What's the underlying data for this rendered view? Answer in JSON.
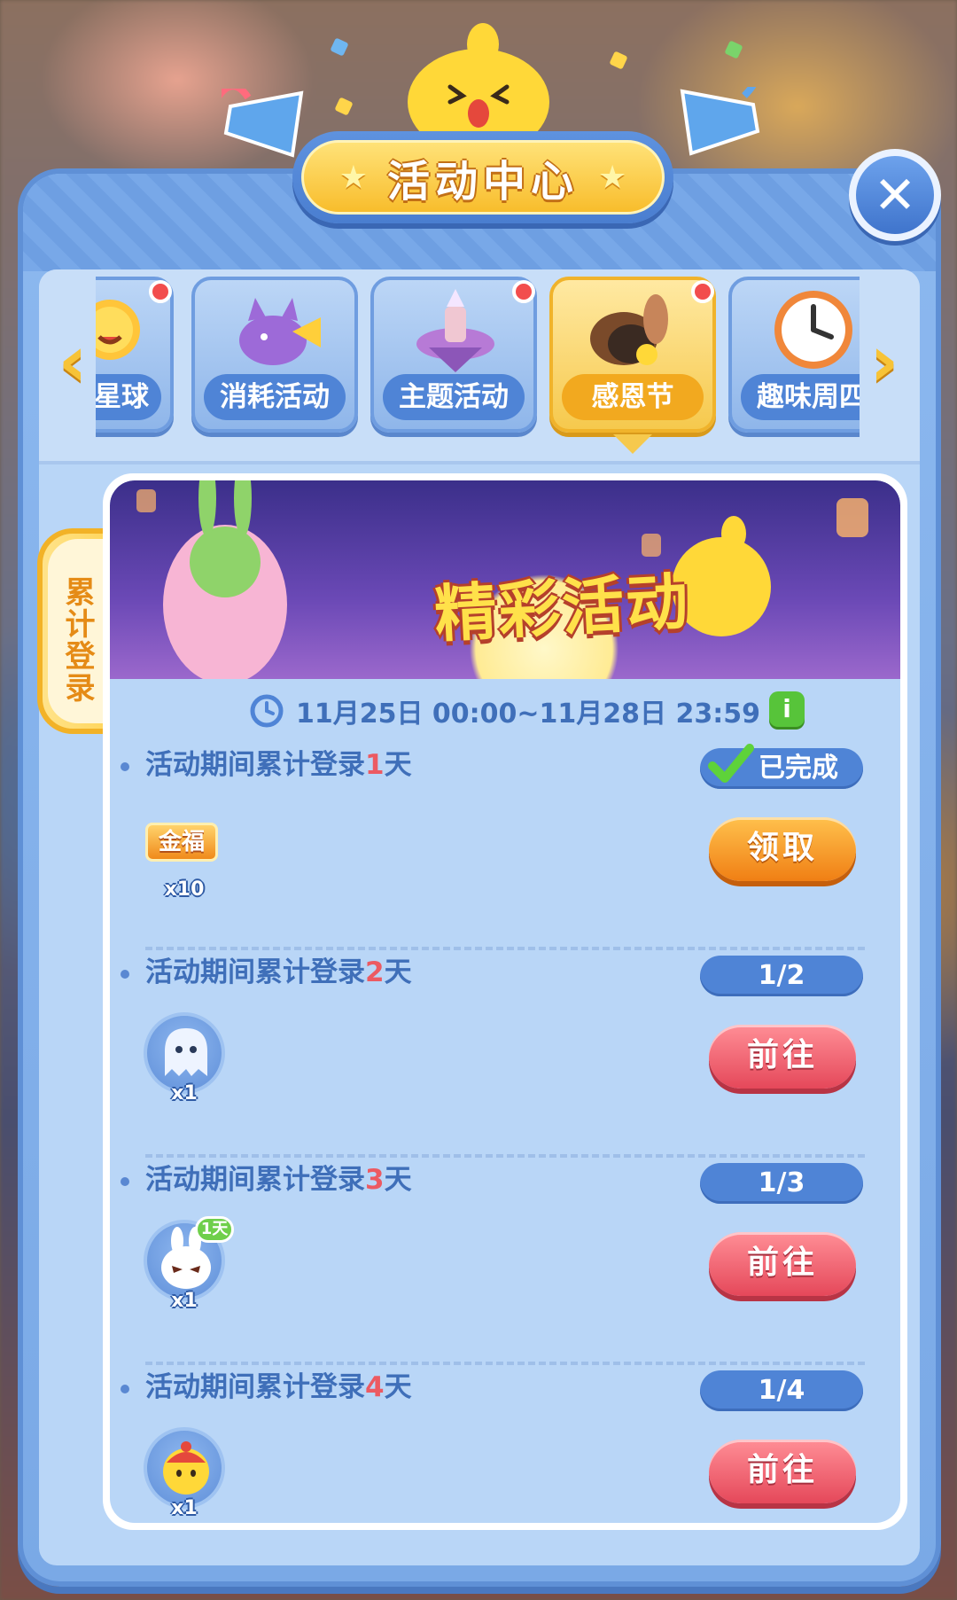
{
  "window": {
    "title": "活动中心"
  },
  "tabs": [
    {
      "label": "星球",
      "has_dot": true,
      "active": false,
      "icon": "sun-icon"
    },
    {
      "label": "消耗活动",
      "has_dot": false,
      "active": false,
      "icon": "cat-trumpet-icon"
    },
    {
      "label": "主题活动",
      "has_dot": true,
      "active": false,
      "icon": "floating-island-icon"
    },
    {
      "label": "感恩节",
      "has_dot": true,
      "active": true,
      "icon": "turkey-icon"
    },
    {
      "label": "趣味周四",
      "has_dot": false,
      "active": false,
      "icon": "clock-icon"
    }
  ],
  "side_tab": {
    "label": "累计登录"
  },
  "banner": {
    "title": "精彩活动"
  },
  "event": {
    "time_range": "11月25日 00:00~11月28日 23:59"
  },
  "tasks": [
    {
      "desc_prefix": "活动期间累计登录",
      "days": "1",
      "desc_suffix": "天",
      "status": "已完成",
      "reward_label": "金福",
      "reward_count": "x10",
      "button": "领取"
    },
    {
      "desc_prefix": "活动期间累计登录",
      "days": "2",
      "desc_suffix": "天",
      "status": "1/2",
      "reward_count": "x1",
      "button": "前往"
    },
    {
      "desc_prefix": "活动期间累计登录",
      "days": "3",
      "desc_suffix": "天",
      "status": "1/3",
      "reward_badge": "1天",
      "reward_count": "x1",
      "button": "前往"
    },
    {
      "desc_prefix": "活动期间累计登录",
      "days": "4",
      "desc_suffix": "天",
      "status": "1/4",
      "reward_count": "x1",
      "button": "前往"
    }
  ],
  "colors": {
    "panel": "#7aa9e6",
    "title_gold": "#f8bd2c",
    "claim_orange": "#f07f14",
    "go_red": "#e5485a",
    "text_blue": "#3f6fb9",
    "highlight_red": "#ec5a62"
  }
}
